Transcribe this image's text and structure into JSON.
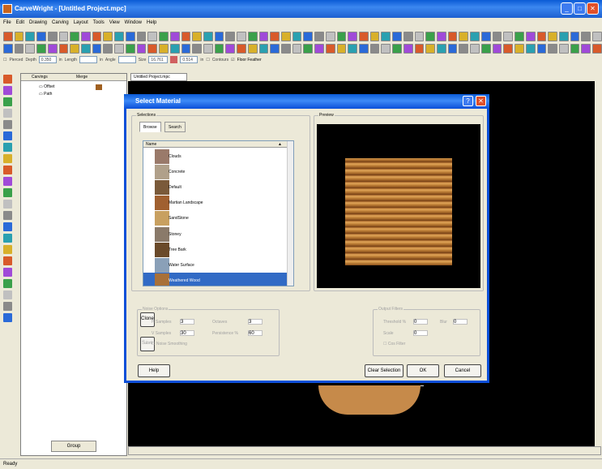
{
  "window": {
    "title": "CarveWright - [Untitled Project.mpc]"
  },
  "menu": [
    "File",
    "Edit",
    "Drawing",
    "Carving",
    "Layout",
    "Tools",
    "View",
    "Window",
    "Help"
  ],
  "options": {
    "pierced": "Pierced",
    "depth_label": "Depth",
    "depth_value": "0.350",
    "in1": "in",
    "length_label": "Length",
    "in2": "in",
    "angle_label": "Angle",
    "size_label": "Size",
    "size_value": "16.761",
    "size2_value": "0.514",
    "in3": "in",
    "contours": "Contours",
    "floor_feather": "Floor Feather"
  },
  "carvings_panel": {
    "col1": "Carvings",
    "col2": "Merge",
    "items": [
      "Offset",
      "Path"
    ],
    "group_button": "Group"
  },
  "doc_tab": "Untitled Project.mpc",
  "status": "Ready",
  "dialog": {
    "title": "Select Material",
    "selections_label": "Selections",
    "preview_label": "Preview",
    "tabs": [
      "Browse",
      "Search"
    ],
    "list_header": "Name",
    "materials": [
      "Clouds",
      "Concrete",
      "Default",
      "Martian Landscape",
      "SandStone",
      "Stoney",
      "Tree Bark",
      "Water Surface",
      "Weathered Wood"
    ],
    "selected": "Weathered Wood",
    "noise_options": {
      "label": "Noise Options",
      "clone": "Clone",
      "save": "Save",
      "h_samples": "H Samples",
      "h_val": "3",
      "octaves": "Octaves",
      "oct_val": "3",
      "v_samples": "V Samples",
      "v_val": "30",
      "persistence": "Persistence %",
      "pers_val": "60",
      "smoothing": "Noise Smoothing"
    },
    "output_filters": {
      "label": "Output Filters",
      "threshold": "Threshold %",
      "thr_val": "0",
      "blur": "Blur",
      "blur_val": "0",
      "scale": "Scale",
      "scale_val": "0",
      "cos_filter": "Cos Filter"
    },
    "buttons": {
      "help": "Help",
      "clear": "Clear Selection",
      "ok": "OK",
      "cancel": "Cancel"
    }
  },
  "colors": {
    "titlebar": "#0a5ad6",
    "selection": "#316ac5",
    "canvas": "#000000",
    "wood": "#c2843a"
  }
}
